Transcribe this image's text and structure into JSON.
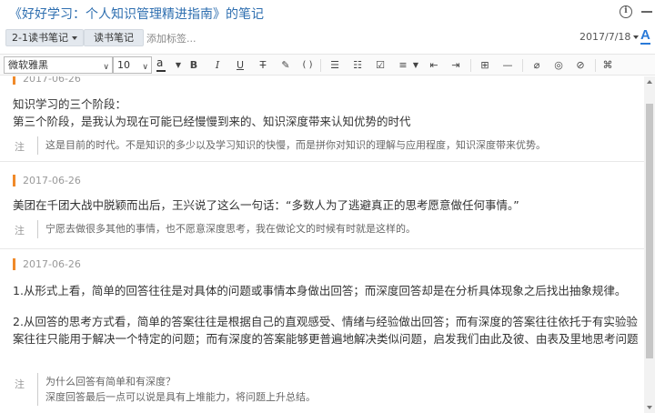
{
  "window": {
    "title": "《好好学习：个人知识管理精进指南》的笔记"
  },
  "meta": {
    "notebook": "2-1读书笔记",
    "tag": "读书笔记",
    "add_tag_placeholder": "添加标签...",
    "date": "2017/7/18",
    "font_icon_label": "A"
  },
  "toolbar": {
    "font_family": "微软雅黑",
    "font_size": "10",
    "text_color_label": "a",
    "bold": "B",
    "italic": "I",
    "underline": "U",
    "strike": "T",
    "code": "( )",
    "shortcut": "⌘"
  },
  "notes": [
    {
      "date": "2017-06-26",
      "lines": [
        "知识学习的三个阶段：",
        "第三个阶段，是我认为现在可能已经慢慢到来的、知识深度带来认知优势的时代"
      ],
      "comment_label": "注",
      "comment": [
        "这是目前的时代。不是知识的多少以及学习知识的快慢，而是拼你对知识的理解与应用程度，知识深度带来优势。"
      ]
    },
    {
      "date": "2017-06-26",
      "lines": [
        "美团在千团大战中脱颖而出后，王兴说了这么一句话：“多数人为了逃避真正的思考愿意做任何事情。”"
      ],
      "comment_label": "注",
      "comment": [
        "宁愿去做很多其他的事情，也不愿意深度思考，我在做论文的时候有时就是这样的。"
      ]
    },
    {
      "date": "2017-06-26",
      "lines": [
        "1.从形式上看，简单的回答往往是对具体的问题或事情本身做出回答；而深度回答却是在分析具体现象之后找出抽象规律。",
        "",
        "2.从回答的思考方式看，简单的答案往往是根据自己的直观感受、情绪与经验做出回答；而有深度的答案往往依托于有实验验",
        "案往往只能用于解决一个特定的问题；而有深度的答案能够更普遍地解决类似问题，启发我们由此及彼、由表及里地思考问题"
      ],
      "comment_label": "注",
      "comment": [
        "为什么回答有简单和有深度？",
        "深度回答最后一点可以说是具有上堆能力，将问题上升总结。"
      ]
    }
  ]
}
